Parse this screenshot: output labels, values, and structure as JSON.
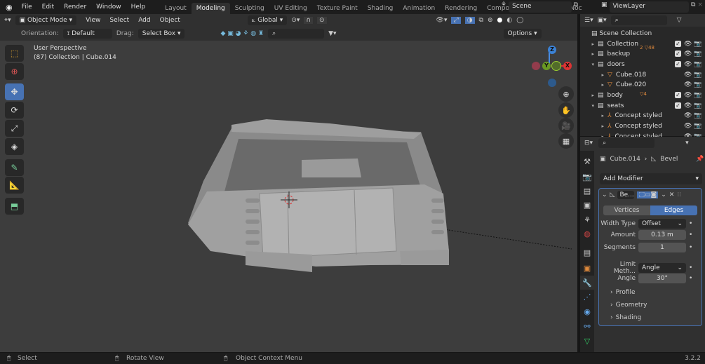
{
  "menu": {
    "items": [
      "File",
      "Edit",
      "Render",
      "Window",
      "Help"
    ]
  },
  "workspaces": [
    "Layout",
    "Modeling",
    "Sculpting",
    "UV Editing",
    "Texture Paint",
    "Shading",
    "Animation",
    "Rendering",
    "Compositing",
    "Geometry Noc"
  ],
  "active_workspace": "Modeling",
  "scene": "Scene",
  "view_layer": "ViewLayer",
  "header": {
    "mode": "Object Mode",
    "view": "View",
    "select": "Select",
    "add": "Add",
    "object": "Object",
    "orientation_global": "Global"
  },
  "tool_settings": {
    "orientation_label": "Orientation:",
    "orientation": "Default",
    "drag_label": "Drag:",
    "drag": "Select Box",
    "options": "Options"
  },
  "viewport": {
    "perspective": "User Perspective",
    "info": "(87) Collection | Cube.014",
    "axis_x": "X",
    "axis_y": "Y",
    "axis_z": "Z"
  },
  "outliner": {
    "root": "Scene Collection",
    "rows": [
      {
        "label": "Collection",
        "badge1": "2",
        "badge2": "48"
      },
      {
        "label": "backup"
      },
      {
        "label": "doors"
      },
      {
        "label": "Cube.018"
      },
      {
        "label": "Cube.020"
      },
      {
        "label": "body",
        "badge2": "4"
      },
      {
        "label": "seats"
      },
      {
        "label": "Concept styled sea"
      },
      {
        "label": "Concept styled sea"
      },
      {
        "label": "Concept styled sea"
      }
    ]
  },
  "properties": {
    "object": "Cube.014",
    "modifier": "Bevel",
    "add_modifier": "Add Modifier",
    "mod_name": "Be...",
    "tab_vertices": "Vertices",
    "tab_edges": "Edges",
    "width_type_label": "Width Type",
    "width_type": "Offset",
    "amount_label": "Amount",
    "amount": "0.13 m",
    "segments_label": "Segments",
    "segments": "1",
    "limit_label": "Limit Meth...",
    "limit": "Angle",
    "angle_label": "Angle",
    "angle": "30°",
    "profile": "Profile",
    "geometry": "Geometry",
    "shading": "Shading"
  },
  "status": {
    "select": "Select",
    "rotate": "Rotate View",
    "context": "Object Context Menu",
    "version": "3.2.2"
  },
  "colors": {
    "accent": "#4772b3",
    "object_orange": "#e08a3c"
  }
}
